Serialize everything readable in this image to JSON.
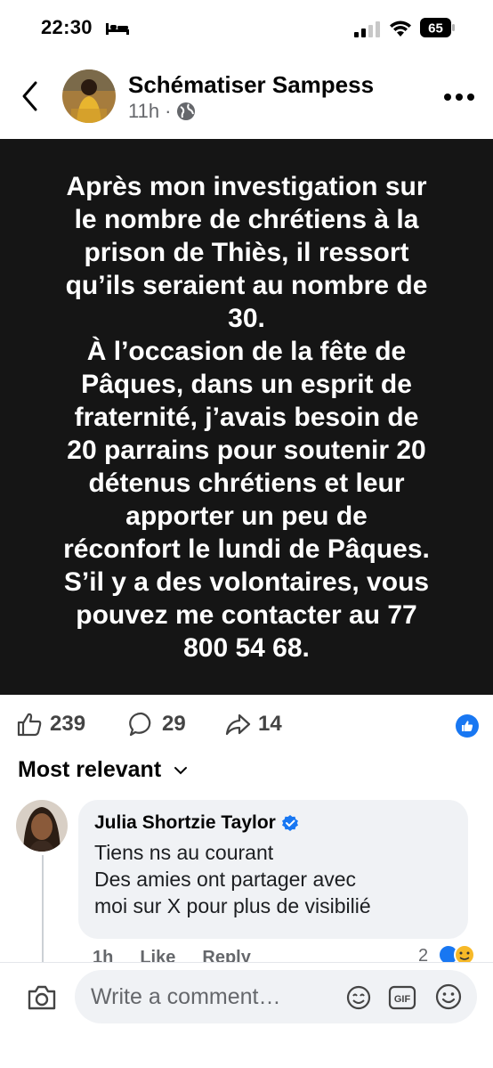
{
  "status_bar": {
    "time": "22:30",
    "battery": "65"
  },
  "post": {
    "author": "Schématiser Sampess",
    "time": "11h",
    "dot": "·",
    "text": "Après mon investigation sur\nle nombre de chrétiens à la\nprison de Thiès, il ressort\nqu’ils seraient au nombre de\n30.\nÀ l’occasion de la fête de\nPâques, dans un esprit de\nfraternité, j’avais besoin de\n20 parrains pour soutenir 20\ndétenus chrétiens et leur\napporter un peu de\nréconfort le lundi de Pâques.\nS’il y a des volontaires, vous\npouvez me contacter au 77\n800 54 68."
  },
  "reactions": {
    "likes": "239",
    "comments": "29",
    "shares": "14"
  },
  "comments": {
    "sort_label": "Most relevant",
    "items": [
      {
        "author": "Julia Shortzie Taylor",
        "text": "Tiens ns au courant\nDes amies ont partager avec\nmoi sur X pour plus de visibilié",
        "time": "1h",
        "like_label": "Like",
        "reply_label": "Reply",
        "reaction_count": "2"
      }
    ]
  },
  "composer": {
    "placeholder": "Write a comment…"
  },
  "colors": {
    "accent": "#1877f2",
    "post_bg": "#151515",
    "muted": "#65676b"
  }
}
